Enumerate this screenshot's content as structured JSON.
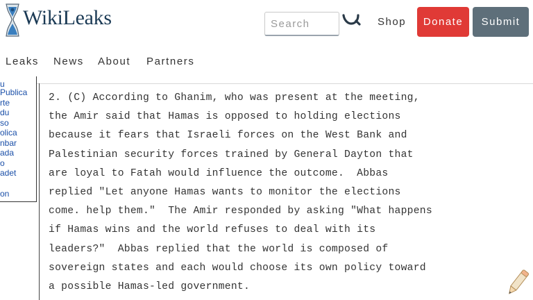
{
  "brand": {
    "name": "WikiLeaks"
  },
  "header": {
    "search_placeholder": "Search",
    "shop": "Shop",
    "donate": "Donate",
    "submit": "Submit"
  },
  "nav": [
    {
      "label": "Leaks"
    },
    {
      "label": "News"
    },
    {
      "label": "About"
    },
    {
      "label": "Partners"
    }
  ],
  "sidebar": {
    "items": [
      "u",
      "Publica",
      "rte",
      "du",
      "so",
      "olica",
      "nbar",
      "ada",
      "o",
      "adet",
      "on"
    ]
  },
  "cable": {
    "lines": [
      "2. (C) According to Ghanim, who was present at the meeting,",
      "the Amir said that Hamas is opposed to holding elections",
      "because it fears that Israeli forces on the West Bank and",
      "Palestinian security forces trained by General Dayton that",
      "are loyal to Fatah would influence the outcome.  Abbas",
      "replied \"Let anyone Hamas wants to monitor the elections",
      "come. help them.\"  The Amir responded by asking \"What happens",
      "if Hamas wins and the world refuses to deal with its",
      "leaders?\"  Abbas replied that the world is composed of",
      "sovereign states and each would choose its own policy toward",
      "a possible Hamas-led government."
    ]
  },
  "colors": {
    "donate": "#e03a36",
    "submit": "#5e6f7a",
    "link": "#1a4fa8",
    "brand": "#1b3a55"
  }
}
